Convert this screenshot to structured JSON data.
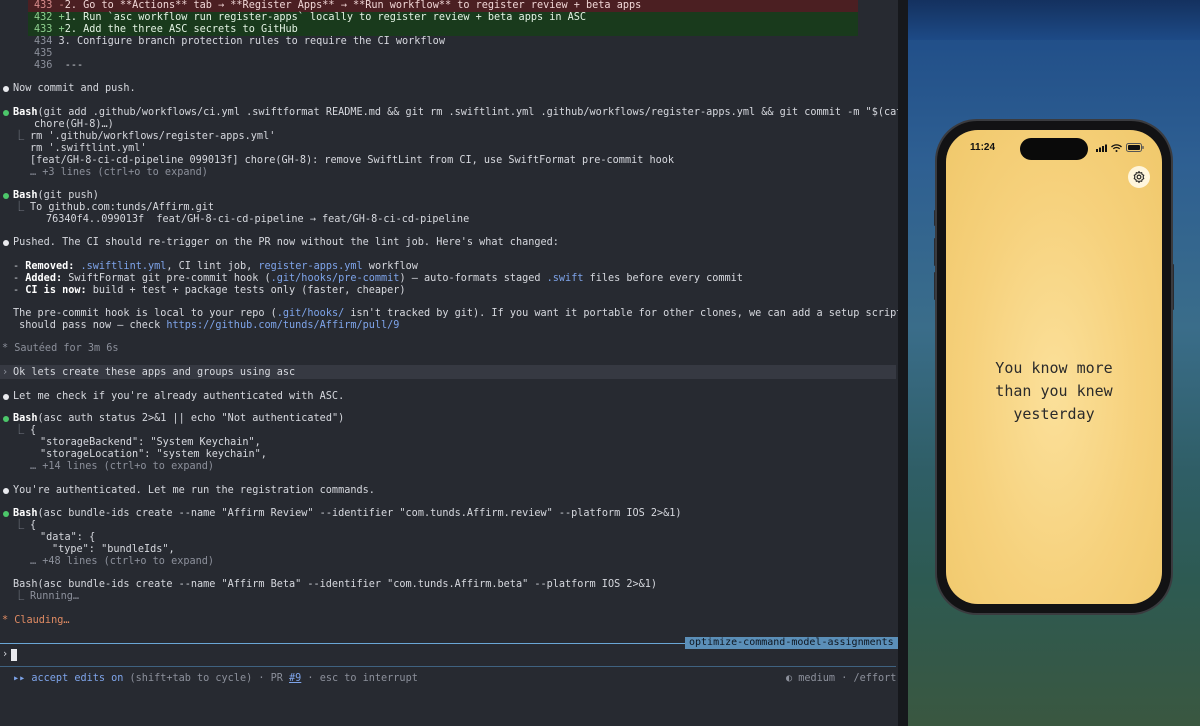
{
  "terminal": {
    "diff": [
      {
        "num": "433",
        "sign": "-",
        "text": "2. Go to **Actions** tab → **Register Apps** → **Run workflow** to register review + beta apps"
      },
      {
        "num": "432",
        "sign": "+",
        "text": "1. Run `asc workflow run register-apps` locally to register review + beta apps in ASC"
      },
      {
        "num": "433",
        "sign": "+",
        "text": "2. Add the three ASC secrets to GitHub"
      },
      {
        "num": "434",
        "sign": " ",
        "text": "3. Configure branch protection rules to require the CI workflow"
      },
      {
        "num": "435",
        "sign": " ",
        "text": ""
      },
      {
        "num": "436",
        "sign": " ",
        "text": "---"
      }
    ],
    "msg_commit": "Now commit and push.",
    "bash1_tool": "Bash",
    "bash1_cmd": "(git add .github/workflows/ci.yml .swiftformat README.md && git rm .swiftlint.yml .github/workflows/register-apps.yml && git commit -m \"$(cat <<'EOF'",
    "bash1_cmd2": "chore(GH-8)…)",
    "bash1_out1": "rm '.github/workflows/register-apps.yml'",
    "bash1_out2": "rm '.swiftlint.yml'",
    "bash1_out3": "[feat/GH-8-ci-cd-pipeline 099013f] chore(GH-8): remove SwiftLint from CI, use SwiftFormat pre-commit hook",
    "bash1_more": "… +3 lines (ctrl+o to expand)",
    "bash2_tool": "Bash",
    "bash2_cmd": "(git push)",
    "bash2_out1": "To github.com:tunds/Affirm.git",
    "bash2_out2": "76340f4..099013f  feat/GH-8-ci-cd-pipeline → feat/GH-8-ci-cd-pipeline",
    "msg_pushed": "Pushed. The CI should re-trigger on the PR now without the lint job. Here's what changed:",
    "removed_label": "Removed:",
    "removed_f1": ".swiftlint.yml",
    "removed_t1": ", CI lint job, ",
    "removed_f2": "register-apps.yml",
    "removed_t2": " workflow",
    "added_label": "Added:",
    "added_t1": " SwiftFormat git pre-commit hook (",
    "added_f1": ".git/hooks/pre-commit",
    "added_t2": ") — auto-formats staged ",
    "added_f2": ".swift",
    "added_t3": " files before every commit",
    "ci_label": "CI is now:",
    "ci_text": " build + test + package tests only (faster, cheaper)",
    "para1a": "The pre-commit hook is local to your repo (",
    "para1_path": ".git/hooks/",
    "para1b": " isn't tracked by git). If you want it portable for other clones, we can add a setup script later. The PR",
    "para2a": " should pass now — check ",
    "para2_link": "https://github.com/tunds/Affirm/pull/9",
    "sauteed": "* Sautéed for 3m 6s",
    "prompt_user": "Ok lets create these apps and groups using asc",
    "msg_check": "Let me check if you're already authenticated with ASC.",
    "bash3_tool": "Bash",
    "bash3_cmd": "(asc auth status 2>&1 || echo \"Not authenticated\")",
    "bash3_out1": "{",
    "bash3_out2": "\"storageBackend\": \"System Keychain\",",
    "bash3_out3": "\"storageLocation\": \"system keychain\",",
    "bash3_more": "… +14 lines (ctrl+o to expand)",
    "msg_auth": "You're authenticated. Let me run the registration commands.",
    "bash4_tool": "Bash",
    "bash4_cmd": "(asc bundle-ids create --name \"Affirm Review\" --identifier \"com.tunds.Affirm.review\" --platform IOS 2>&1)",
    "bash4_out1": "{",
    "bash4_out2": "\"data\": {",
    "bash4_out3": "\"type\": \"bundleIds\",",
    "bash4_more": "… +48 lines (ctrl+o to expand)",
    "bash5_line": "Bash(asc bundle-ids create --name \"Affirm Beta\" --identifier \"com.tunds.Affirm.beta\" --platform IOS 2>&1)",
    "bash5_status": "Running…",
    "clauding": "* Clauding…",
    "branch": "optimize-command-model-assignments",
    "status_accept": "▸▸ accept edits on",
    "status_cycle": " (shift+tab to cycle) · PR ",
    "status_pr": "#9",
    "status_esc": " · esc to interrupt",
    "status_right": "◐ medium · /effort"
  },
  "phone": {
    "time": "11:24",
    "quote": [
      "You know more",
      "than you knew",
      "yesterday"
    ]
  },
  "colors": {
    "accent_green": "#4cc76a",
    "link_blue": "#7ea4ea",
    "spinner_orange": "#e08b63",
    "phone_bg": "#f6d17c"
  },
  "icons": [
    "settings-gear-icon",
    "wifi-icon",
    "battery-icon",
    "signal-icon"
  ]
}
